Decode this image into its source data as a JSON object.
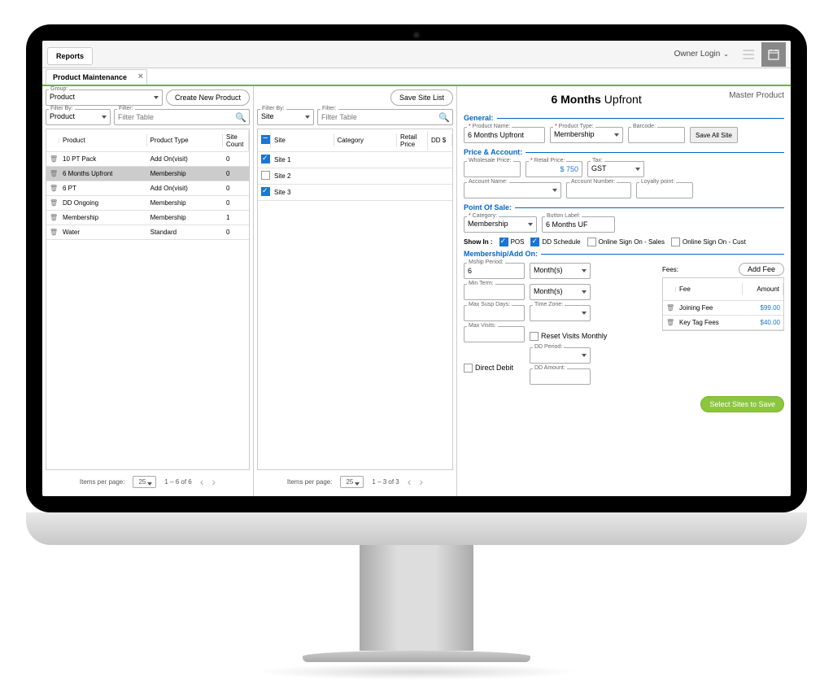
{
  "topbar": {
    "reports": "Reports",
    "owner": "Owner Login"
  },
  "tab": {
    "title": "Product Maintenance"
  },
  "col1": {
    "groupLabel": "Group:",
    "groupValue": "Product",
    "createBtn": "Create New Product",
    "filterByLabel": "Filter By:",
    "filterByValue": "Product",
    "filterLabel": "Filter:",
    "filterPlaceholder": "Filter Table",
    "headers": {
      "c1": "",
      "c2": "Product",
      "c3": "Product Type",
      "c4": "Site Count"
    },
    "rows": [
      {
        "product": "10 PT Pack",
        "type": "Add On(visit)",
        "count": "0",
        "sel": false
      },
      {
        "product": "6 Months Upfront",
        "type": "Membership",
        "count": "0",
        "sel": true
      },
      {
        "product": "6 PT",
        "type": "Add On(visit)",
        "count": "0",
        "sel": false
      },
      {
        "product": "DD Ongoing",
        "type": "Membership",
        "count": "0",
        "sel": false
      },
      {
        "product": "Membership",
        "type": "Membership",
        "count": "1",
        "sel": false
      },
      {
        "product": "Water",
        "type": "Standard",
        "count": "0",
        "sel": false
      }
    ],
    "pager": {
      "itemsLabel": "Items per page:",
      "items": "25",
      "range": "1 – 6 of 6"
    }
  },
  "col2": {
    "saveSiteList": "Save Site List",
    "filterByLabel": "Filter By:",
    "filterByValue": "Site",
    "filterLabel": "Filter:",
    "filterPlaceholder": "Filter Table",
    "headers": {
      "c1": "",
      "c2": "Site",
      "c3": "Category",
      "c4": "Retail Price",
      "c5": "DD $"
    },
    "rows": [
      {
        "site": "Site 1",
        "cat": "",
        "price": "",
        "dd": "",
        "chk": true
      },
      {
        "site": "Site 2",
        "cat": "",
        "price": "",
        "dd": "",
        "chk": false
      },
      {
        "site": "Site 3",
        "cat": "",
        "price": "",
        "dd": "",
        "chk": true
      }
    ],
    "pager": {
      "itemsLabel": "Items per page:",
      "items": "25",
      "range": "1 – 3 of 3"
    }
  },
  "detail": {
    "title1": "6 Months",
    "title2": "Upfront",
    "master": "Master Product",
    "general": {
      "hdr": "General:",
      "nameLabel": "Product Name:",
      "name": "6 Months Upfront",
      "typeLabel": "Product Type:",
      "type": "Membership",
      "barcodeLabel": "Barcode:",
      "saveAll": "Save All Site"
    },
    "price": {
      "hdr": "Price & Account:",
      "wsLabel": "Wholesale Price:",
      "rpLabel": "Retail Price:",
      "rp": "$ 750",
      "taxLabel": "Tax:",
      "tax": "GST",
      "accNameLabel": "Account Name:",
      "accNumLabel": "Account Number:",
      "loyaltyLabel": "Loyalty point:"
    },
    "pos": {
      "hdr": "Point Of Sale:",
      "catLabel": "Category:",
      "cat": "Membership",
      "btnLabel": "Button Label:",
      "btn": "6 Months UF"
    },
    "showin": {
      "label": "Show In :",
      "pos": "POS",
      "dd": "DD Schedule",
      "sales": "Online Sign On - Sales",
      "cust": "Online Sign On - Cust"
    },
    "mship": {
      "hdr": "Membership/Add On:",
      "periodLabel": "Mship Period:",
      "period": "6",
      "periodUnit": "Month(s)",
      "minTermLabel": "Min Term:",
      "minTermUnit": "Month(s)",
      "maxSuspLabel": "Max Susp Days:",
      "tzLabel": "Time Zone:",
      "maxVisitsLabel": "Max Visits:",
      "resetLabel": "Reset Visits Monthly",
      "ddLabel": "Direct Debit",
      "ddPeriodLabel": "DD Period:",
      "ddAmountLabel": "DD Amount:"
    },
    "fees": {
      "hdr": "Fees:",
      "addBtn": "Add Fee",
      "colFee": "Fee",
      "colAmt": "Amount",
      "rows": [
        {
          "name": "Joining Fee",
          "amt": "$99.00"
        },
        {
          "name": "Key Tag Fees",
          "amt": "$40.00"
        }
      ]
    },
    "selectSites": "Select Sites to Save"
  }
}
